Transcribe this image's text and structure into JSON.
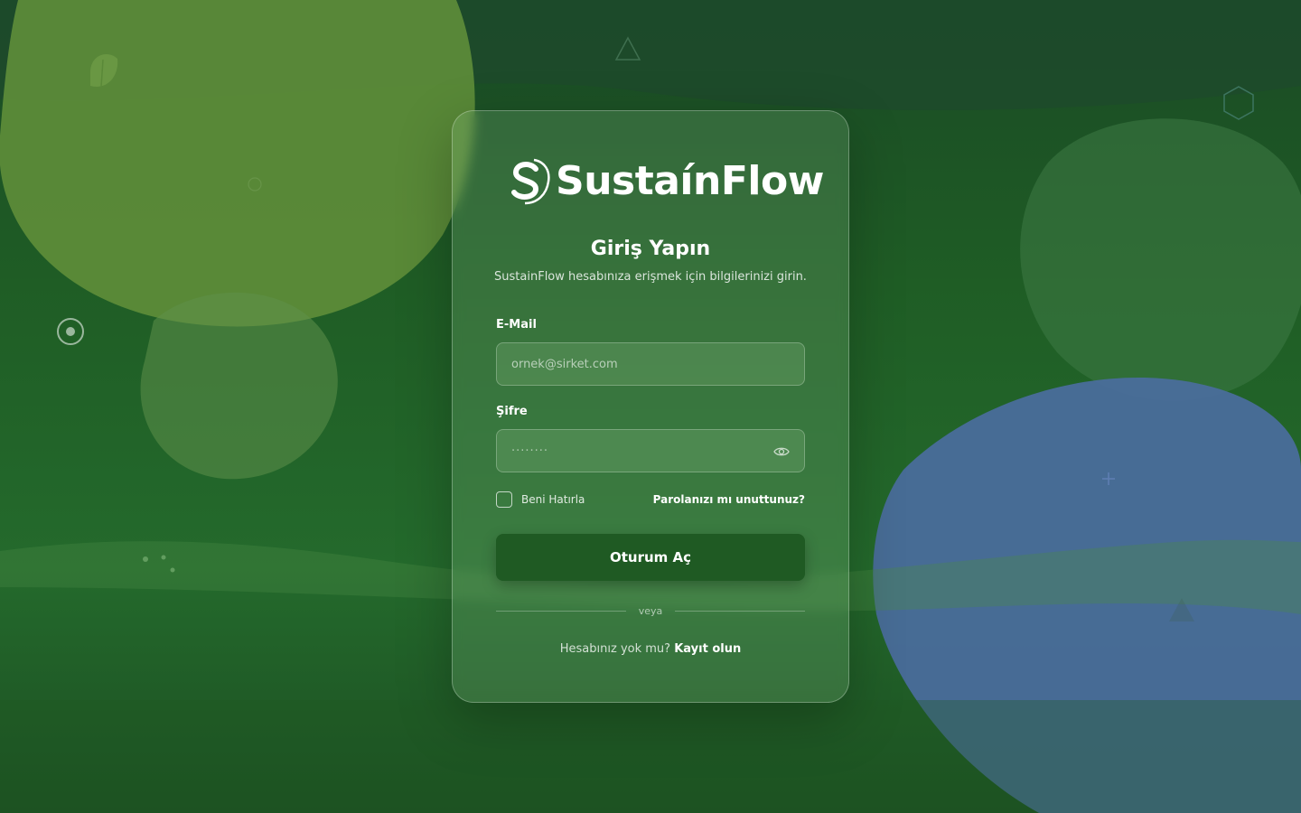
{
  "brand": {
    "name": "SustaínFlow"
  },
  "login": {
    "title": "Giriş Yapın",
    "subtitle": "SustainFlow hesabınıza erişmek için bilgilerinizi girin.",
    "email_label": "E-Mail",
    "email_placeholder": "ornek@sirket.com",
    "password_label": "Şifre",
    "password_value": "········",
    "remember_label": "Beni Hatırla",
    "forgot_link": "Parolanızı mı unuttunuz?",
    "submit_label": "Oturum Aç",
    "divider_text": "veya",
    "signup_prompt": "Hesabınız yok mu?",
    "signup_link": "Kayıt olun"
  },
  "colors": {
    "background": "#1f5d25",
    "button": "#1f5a23",
    "blob_green": "#5a8a38",
    "blob_blue": "#4a6a9a"
  },
  "icons": [
    "logo-icon",
    "eye-icon",
    "leaf-icon",
    "triangle-icon",
    "hexagon-icon",
    "target-icon"
  ]
}
